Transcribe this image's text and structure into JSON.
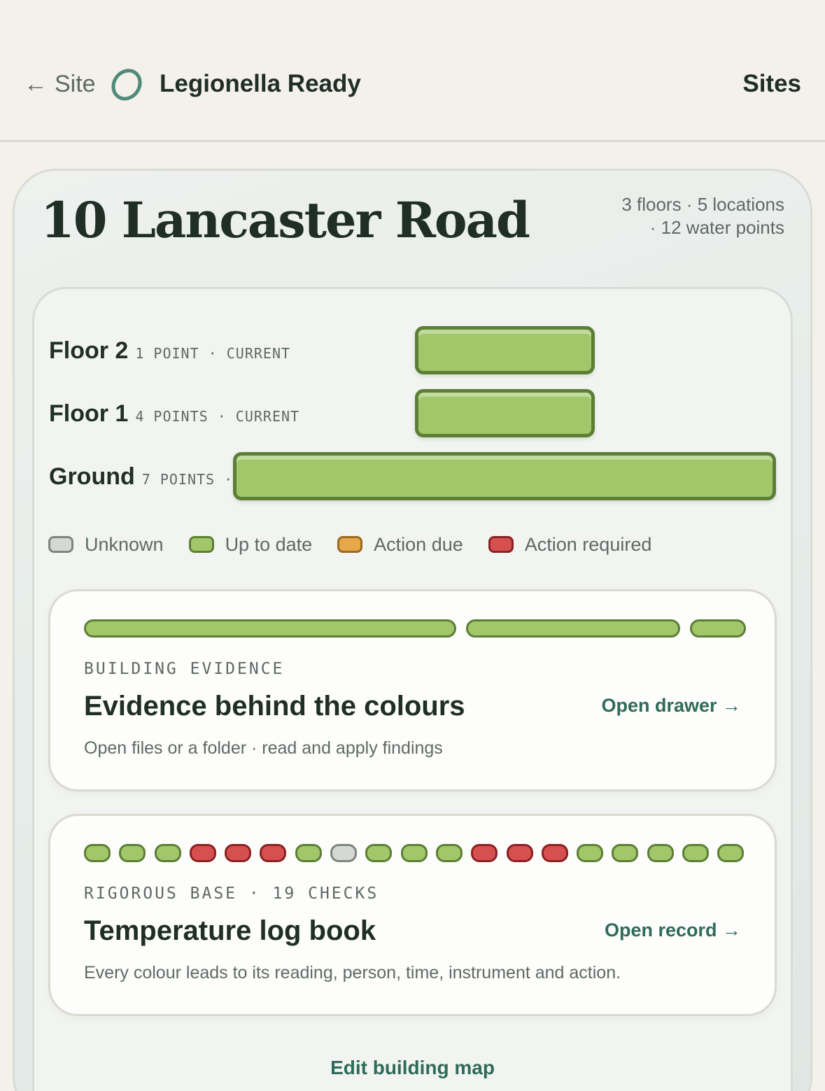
{
  "header": {
    "back_arrow": "←",
    "back_label": "Site",
    "app_title": "Legionella Ready",
    "sites_label": "Sites",
    "logo_icon": "ring-logo-icon",
    "logo_color": "#4f8a7a"
  },
  "building": {
    "name": "10 Lancaster Road",
    "meta_line1": "3 floors · 5 locations",
    "meta_line2": "· 12 water points"
  },
  "floors": [
    {
      "name": "Floor 2",
      "meta": "1 POINT · CURRENT",
      "status": "up-to-date"
    },
    {
      "name": "Floor 1",
      "meta": "4 POINTS · CURRENT",
      "status": "up-to-date"
    },
    {
      "name": "Ground",
      "meta": "7 POINTS ·",
      "status": "up-to-date"
    }
  ],
  "legend": [
    {
      "label": "Unknown",
      "fill": "#d6d8d6",
      "stroke": "#7c8580"
    },
    {
      "label": "Up to date",
      "fill": "#a2c66a",
      "stroke": "#5c7f36"
    },
    {
      "label": "Action due",
      "fill": "#e6a84a",
      "stroke": "#9a6a1e"
    },
    {
      "label": "Action required",
      "fill": "#d65050",
      "stroke": "#8a2222"
    }
  ],
  "evidence_card": {
    "eyebrow": "BUILDING EVIDENCE",
    "title": "Evidence behind the colours",
    "link": "Open drawer →",
    "description": "Open files or a folder · read and apply findings",
    "segments_status": [
      "up-to-date",
      "up-to-date",
      "up-to-date"
    ]
  },
  "logbook_card": {
    "eyebrow": "RIGOROUS BASE · 19 CHECKS",
    "title": "Temperature log book",
    "link": "Open record →",
    "description": "Every colour leads to its reading, person, time, instrument and action.",
    "checks": [
      "up-to-date",
      "up-to-date",
      "up-to-date",
      "action-required",
      "action-required",
      "action-required",
      "up-to-date",
      "unknown",
      "up-to-date",
      "up-to-date",
      "up-to-date",
      "action-required",
      "action-required",
      "action-required",
      "up-to-date",
      "up-to-date",
      "up-to-date",
      "up-to-date",
      "up-to-date"
    ]
  },
  "footer": {
    "edit_map_label": "Edit building map"
  }
}
